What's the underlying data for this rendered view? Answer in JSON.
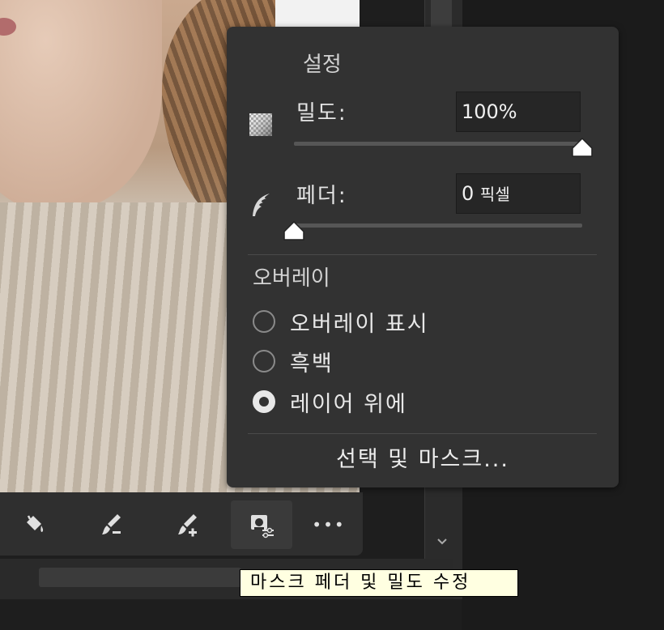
{
  "panel": {
    "settings_title": "설정",
    "density": {
      "label": "밀도:",
      "value": "100%",
      "level_percent": 100
    },
    "feather": {
      "label": "페더:",
      "value": "0",
      "unit": "픽셀",
      "level_percent": 0
    },
    "overlay_title": "오버레이",
    "overlay_options": [
      {
        "label": "오버레이 표시",
        "checked": false
      },
      {
        "label": "흑백",
        "checked": false
      },
      {
        "label": "레이어 위에",
        "checked": true
      }
    ],
    "select_and_mask": "선택 및 마스크..."
  },
  "toolbar": {
    "tools": [
      {
        "icon": "paint-bucket-icon"
      },
      {
        "icon": "brush-subtract-icon"
      },
      {
        "icon": "brush-add-icon"
      },
      {
        "icon": "mask-feather-density-icon",
        "active": true
      },
      {
        "icon": "more-icon",
        "glyph": "•••"
      }
    ]
  },
  "tooltip": {
    "text": "마스크 페더 및 밀도 수정"
  },
  "colors": {
    "panel_bg": "#323232",
    "toolbar_bg": "#2f2f2f",
    "tooltip_bg": "#ffffe1"
  }
}
